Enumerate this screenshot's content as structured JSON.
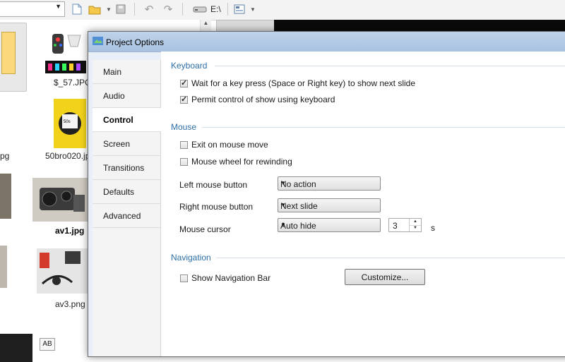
{
  "toolbar": {
    "drive_label": "E:\\",
    "icons": [
      "new-file-icon",
      "open-folder-icon",
      "save-icon",
      "undo-icon",
      "redo-icon",
      "drive-icon",
      "view-icon"
    ]
  },
  "files": {
    "items": [
      {
        "name": "$_57.JPG"
      },
      {
        "name": "pg"
      },
      {
        "name": "50bro020.jp"
      },
      {
        "name": "av1.jpg"
      },
      {
        "name": "av3.png"
      }
    ],
    "ab_button": "AB"
  },
  "dialog": {
    "title": "Project Options",
    "tabs": [
      {
        "label": "Main"
      },
      {
        "label": "Audio"
      },
      {
        "label": "Control"
      },
      {
        "label": "Screen"
      },
      {
        "label": "Transitions"
      },
      {
        "label": "Defaults"
      },
      {
        "label": "Advanced"
      }
    ],
    "active_tab": "Control",
    "keyboard": {
      "title": "Keyboard",
      "wait_key": {
        "label": "Wait for a key press (Space or Right key) to show next slide",
        "checked": true
      },
      "permit_keyboard": {
        "label": "Permit control of show using keyboard",
        "checked": true
      }
    },
    "mouse": {
      "title": "Mouse",
      "exit_on_move": {
        "label": "Exit on mouse move",
        "checked": false
      },
      "wheel_rewind": {
        "label": "Mouse wheel for rewinding",
        "checked": false
      },
      "left_button": {
        "label": "Left mouse button",
        "value": "No action"
      },
      "right_button": {
        "label": "Right mouse button",
        "value": "Next slide"
      },
      "cursor": {
        "label": "Mouse cursor",
        "value": "Auto hide",
        "seconds": "3",
        "unit": "s"
      }
    },
    "navigation": {
      "title": "Navigation",
      "show_bar": {
        "label": "Show Navigation Bar",
        "checked": false
      },
      "customize_label": "Customize..."
    }
  }
}
